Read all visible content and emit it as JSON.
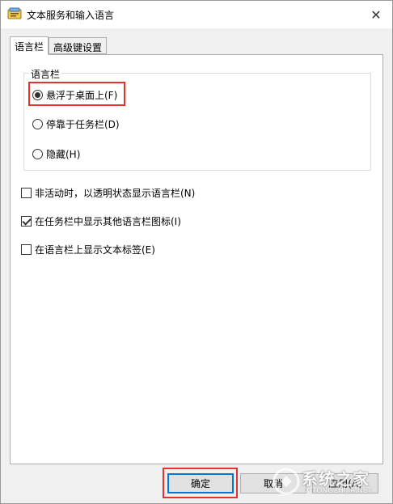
{
  "window": {
    "title": "文本服务和输入语言"
  },
  "tabs": [
    {
      "label": "语言栏"
    },
    {
      "label": "高级键设置"
    }
  ],
  "language_bar_group": {
    "legend": "语言栏",
    "options": [
      {
        "label": "悬浮于桌面上(F)",
        "selected": true
      },
      {
        "label": "停靠于任务栏(D)",
        "selected": false
      },
      {
        "label": "隐藏(H)",
        "selected": false
      }
    ]
  },
  "checkboxes": [
    {
      "label": "非活动时，以透明状态显示语言栏(N)",
      "checked": false
    },
    {
      "label": "在任务栏中显示其他语言栏图标(I)",
      "checked": true
    },
    {
      "label": "在语言栏上显示文本标签(E)",
      "checked": false
    }
  ],
  "buttons": {
    "ok": "确定",
    "cancel": "取消",
    "apply": "应用(A)"
  },
  "watermark": {
    "brand": "系统之家",
    "url": "XITONGZHIJIA.NET"
  },
  "colors": {
    "highlight": "#e8312f",
    "accent": "#0078d7"
  }
}
